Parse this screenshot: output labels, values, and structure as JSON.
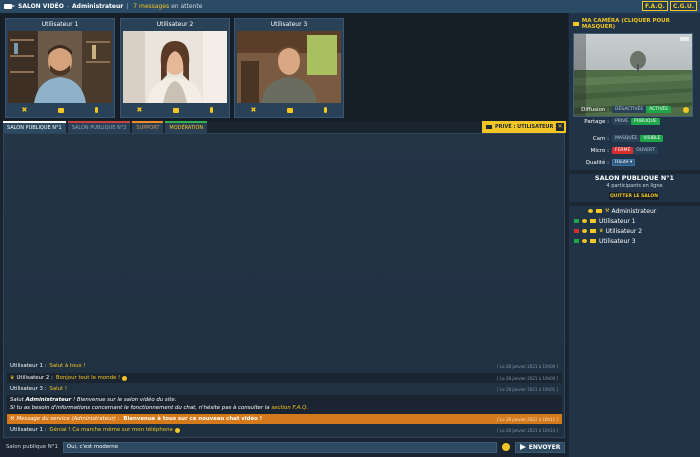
{
  "topbar": {
    "title": "SALON VIDÉO",
    "separator": "-",
    "user": "Administrateur",
    "pipe": "|",
    "messages_count": "7 messages",
    "messages_suffix": "en attente",
    "faq_label": "F.A.Q.",
    "cgu_label": "C.G.U."
  },
  "videos": [
    {
      "name": "Utilisateur 1"
    },
    {
      "name": "Utilisateur 2"
    },
    {
      "name": "Utilisateur 3"
    }
  ],
  "tabs": [
    {
      "label": "SALON PUBLIQUE N°1"
    },
    {
      "label": "SALON PUBLIQUE N°2"
    },
    {
      "label": "SUPPORT"
    },
    {
      "label": "MODÉRATION"
    }
  ],
  "private_tab": {
    "label": "PRIVÉ : UTILISATEUR 1",
    "close": "✕"
  },
  "messages": [
    {
      "who": "Utilisateur 1 :",
      "text": "Salut à tous !",
      "time": "[ Le 28 janvier 2021 à 10h00 ]"
    },
    {
      "who": "Utilisateur 2 :",
      "text": "Bonjour tout le monde !",
      "time": "[ Le 28 janvier 2021 à 10h00 ]"
    },
    {
      "who": "Utilisateur 3 :",
      "text": "Salut !",
      "time": "[ Le 28 janvier 2021 à 10h01 ]"
    }
  ],
  "info_message": {
    "line1_pre": "Salut ",
    "line1_user": "Administrateur",
    "line1_post": " ! Bienvenue sur le salon vidéo du site.",
    "line2_pre": "Si tu as besoin d'informations concernant le fonctionnement du chat, n'hésite pas à consulter la ",
    "line2_link": "section F.A.Q.",
    "line2_post": ""
  },
  "service_message": {
    "who": "Message du service (Administrateur) :",
    "text": "Bienvenue à tous sur ce nouveau chat vidéo !",
    "time": "[ Le 28 janvier 2021 à 10h11 ]"
  },
  "last_message": {
    "who": "Utilisateur 1 :",
    "text": "Génial ! Ca marche même sur mon téléphone",
    "time": "[ Le 28 janvier 2021 à 10h14 ]"
  },
  "input": {
    "room": "Salon publique N°1",
    "value": "Oui, c'est moderne",
    "send_label": "ENVOYER"
  },
  "right_panel": {
    "header": "MA CAMÉRA (CLIQUER POUR MASQUER)",
    "diffusion": {
      "label": "Diffusion :",
      "off": "DÉSACTIVÉE",
      "on": "ACTIVÉE"
    },
    "partage": {
      "label": "Partage :",
      "priv": "PRIVÉ",
      "pub": "PUBLIQUE"
    },
    "cam": {
      "label": "Cam :",
      "off": "MASQUÉE",
      "on": "VISIBLE"
    },
    "micro": {
      "label": "Micro :",
      "closed": "FERMÉ",
      "open": "OUVERT"
    },
    "qualite": {
      "label": "Qualité :",
      "value": "Haute ▾"
    },
    "room_title": "SALON PUBLIQUE N°1",
    "room_sub": "4 participants en ligne",
    "quit_label": "QUITTER LE SALON",
    "participants": [
      {
        "name": "Administrateur",
        "cam": "",
        "admin": true
      },
      {
        "name": "Utilisateur 1",
        "cam": "#1fa64a",
        "admin": false
      },
      {
        "name": "Utilisateur 2",
        "cam": "#d43030",
        "admin": false,
        "crown": true
      },
      {
        "name": "Utilisateur 3",
        "cam": "#1fa64a",
        "admin": false
      }
    ]
  },
  "colors": {
    "accent": "#f3c623",
    "topbar": "#2b4a66",
    "service": "#d47a1c"
  }
}
